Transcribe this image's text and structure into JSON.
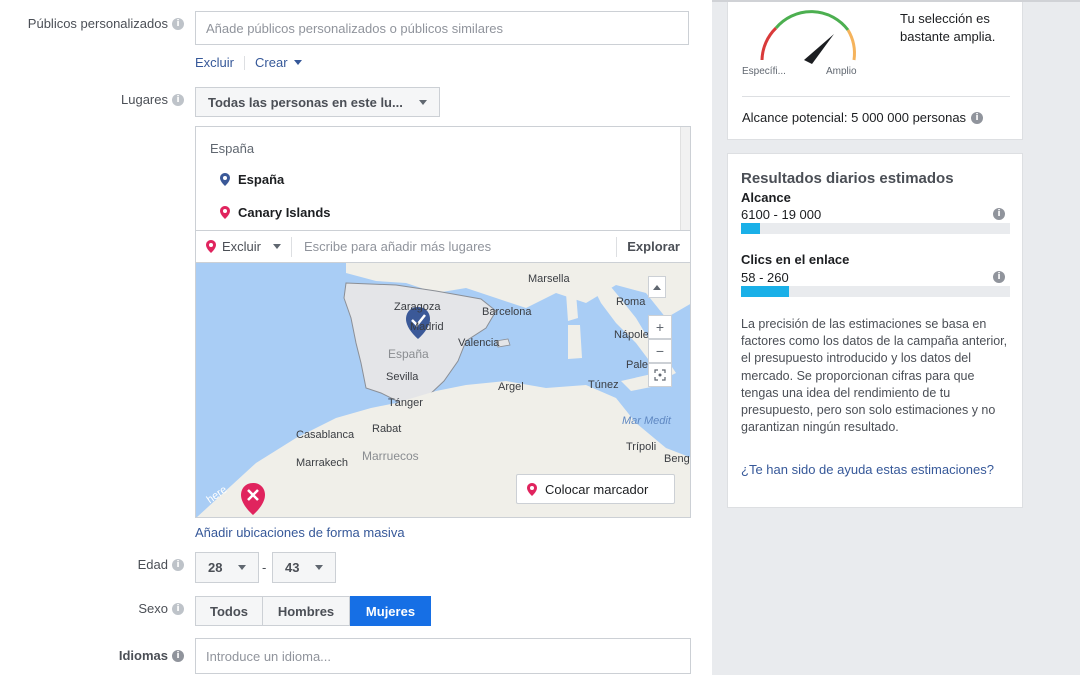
{
  "custom_audiences": {
    "label": "Públicos personalizados",
    "placeholder": "Añade públicos personalizados o públicos similares",
    "exclude_link": "Excluir",
    "create_link": "Crear"
  },
  "locations": {
    "label": "Lugares",
    "dropdown_value": "Todas las personas en este lu...",
    "group_header": "España",
    "items": [
      {
        "label": "España",
        "pin_color": "#3b5998"
      },
      {
        "label": "Canary Islands",
        "pin_color": "#e0245e"
      }
    ],
    "exclude_label": "Excluir",
    "add_placeholder": "Escribe para añadir más lugares",
    "explore_label": "Explorar",
    "bulk_link": "Añadir ubicaciones de forma masiva",
    "map": {
      "place_marker_label": "Colocar marcador",
      "zoom_in": "+",
      "zoom_out": "−",
      "labels": {
        "marsella": "Marsella",
        "zaragoza": "Zaragoza",
        "madrid": "Madrid",
        "barcelona": "Barcelona",
        "valencia": "Valencia",
        "espana": "España",
        "sevilla": "Sevilla",
        "tanger": "Tánger",
        "roma": "Roma",
        "napoles": "Nápoles",
        "palermo": "Palermo",
        "argel": "Argel",
        "tunez": "Túnez",
        "casablanca": "Casablanca",
        "rabat": "Rabat",
        "marruecos": "Marruecos",
        "marrakech": "Marrakech",
        "mar_medit": "Mar Medit",
        "tripoli": "Trípoli",
        "beng": "Beng",
        "here": "here"
      }
    }
  },
  "age": {
    "label": "Edad",
    "min": "28",
    "max": "43",
    "separator": "-"
  },
  "gender": {
    "label": "Sexo",
    "options": [
      "Todos",
      "Hombres",
      "Mujeres"
    ],
    "selected": "Mujeres"
  },
  "languages": {
    "label": "Idiomas",
    "placeholder": "Introduce un idioma..."
  },
  "audience_size": {
    "status_text": "Tu selección es bastante amplia.",
    "gauge_left": "Específi...",
    "gauge_right": "Amplio",
    "potential_reach": "Alcance potencial: 5 000 000 personas"
  },
  "daily_results": {
    "title": "Resultados diarios estimados",
    "reach_label": "Alcance",
    "reach_value": "6100 - 19 000",
    "reach_fill": 0.07,
    "clicks_label": "Clics en el enlace",
    "clicks_value": "58 - 260",
    "clicks_fill": 0.18,
    "disclaimer": "La precisión de las estimaciones se basa en factores como los datos de la campaña anterior, el presupuesto introducido y los datos del mercado. Se proporcionan cifras para que tengas una idea del rendimiento de tu presupuesto, pero son solo estimaciones y no garantizan ningún resultado.",
    "feedback_link": "¿Te han sido de ayuda estas estimaciones?"
  },
  "colors": {
    "link": "#365899",
    "active_segment": "#166fe5",
    "progress": "#1ab0e8",
    "map_water": "#a9cdf5",
    "map_land": "#f0efe9"
  }
}
